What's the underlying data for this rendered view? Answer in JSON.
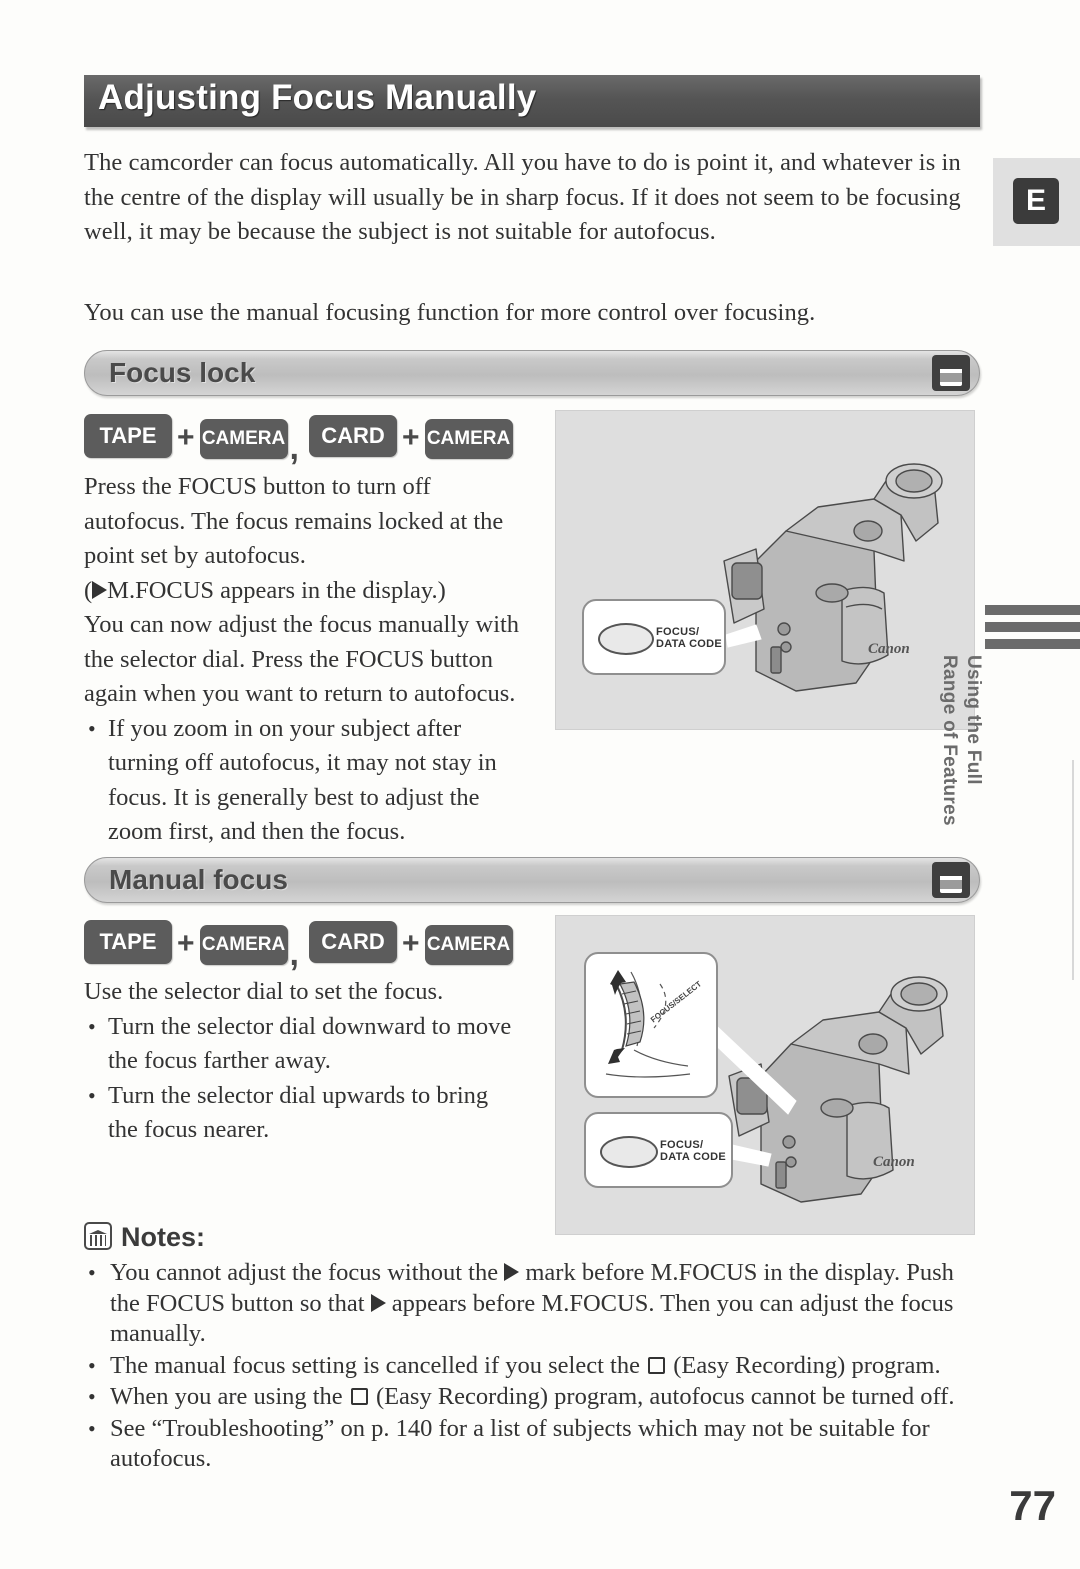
{
  "header": {
    "title": "Adjusting Focus Manually"
  },
  "intro": {
    "paragraph1": "The camcorder can focus automatically. All you have to do is point it, and whatever is in the centre of the display will usually be in sharp focus. If it does not seem to be focusing well, it may be because the subject is not suitable for autofocus.",
    "paragraph2": "You can use the manual focusing function for more control over focusing."
  },
  "sections": [
    {
      "bar_label": "Focus lock",
      "icon": "card-camera-icon",
      "badges": {
        "tape": "TAPE",
        "camera": "CAMERA",
        "card": "CARD",
        "camera2": "CAMERA",
        "plus": "+",
        "comma": ","
      },
      "body_lines": [
        "Press the FOCUS button to turn off autofocus. The focus remains locked at the point set by autofocus.",
        "(▶M.FOCUS appears in the display.)",
        "You can now adjust the focus manually with the selector dial. Press the FOCUS button again when you want to return to autofocus."
      ],
      "body_pre_triangle": "(",
      "body_post_triangle": "M.FOCUS appears in the display.)",
      "bullets": [
        "If you zoom in on your subject after turning off autofocus, it may not stay in focus. It is generally best to adjust the zoom first, and then the focus."
      ],
      "illustration": {
        "name": "camcorder-focus-button-illustration",
        "callout_label": "FOCUS/\nDATA CODE",
        "brand": "Canon"
      }
    },
    {
      "bar_label": "Manual focus",
      "icon": "card-camera-icon",
      "badges": {
        "tape": "TAPE",
        "camera": "CAMERA",
        "card": "CARD",
        "camera2": "CAMERA",
        "plus": "+",
        "comma": ","
      },
      "body_lines": [
        "Use the selector dial to set the focus."
      ],
      "bullets": [
        "Turn the selector dial downward to move the focus farther away.",
        "Turn the selector dial upwards to bring the focus nearer."
      ],
      "illustration": {
        "name": "camcorder-selector-dial-illustration",
        "callout_label": "FOCUS/\nDATA CODE",
        "dial_label": "FOCUS/SELECT",
        "brand": "Canon"
      }
    }
  ],
  "notes": {
    "heading": "Notes:",
    "icon": "notes-book-icon",
    "items": [
      {
        "part1": "You cannot adjust the focus without the ",
        "part2": " mark before M.FOCUS in the display. Push the FOCUS button so that ",
        "part3": " appears before M.FOCUS. Then you can adjust the focus manually."
      },
      {
        "part1": "The manual focus setting is cancelled if you select the ",
        "part2": " (Easy Recording) program."
      },
      {
        "part1": "When you are using the ",
        "part2": " (Easy Recording) program, autofocus cannot be turned off."
      },
      {
        "full": "See “Troubleshooting” on p. 140 for a list of subjects which may not be suitable for autofocus."
      }
    ]
  },
  "page_number": "77",
  "margin": {
    "language_tab": "E",
    "side_tab_text": "Using the Full\nRange of Features"
  },
  "colors": {
    "banner_dark": "#555555",
    "section_bar": "#c9c9c9",
    "badge": "#5c5c5c",
    "text": "#333333",
    "illustration_bg": "#dedede"
  }
}
